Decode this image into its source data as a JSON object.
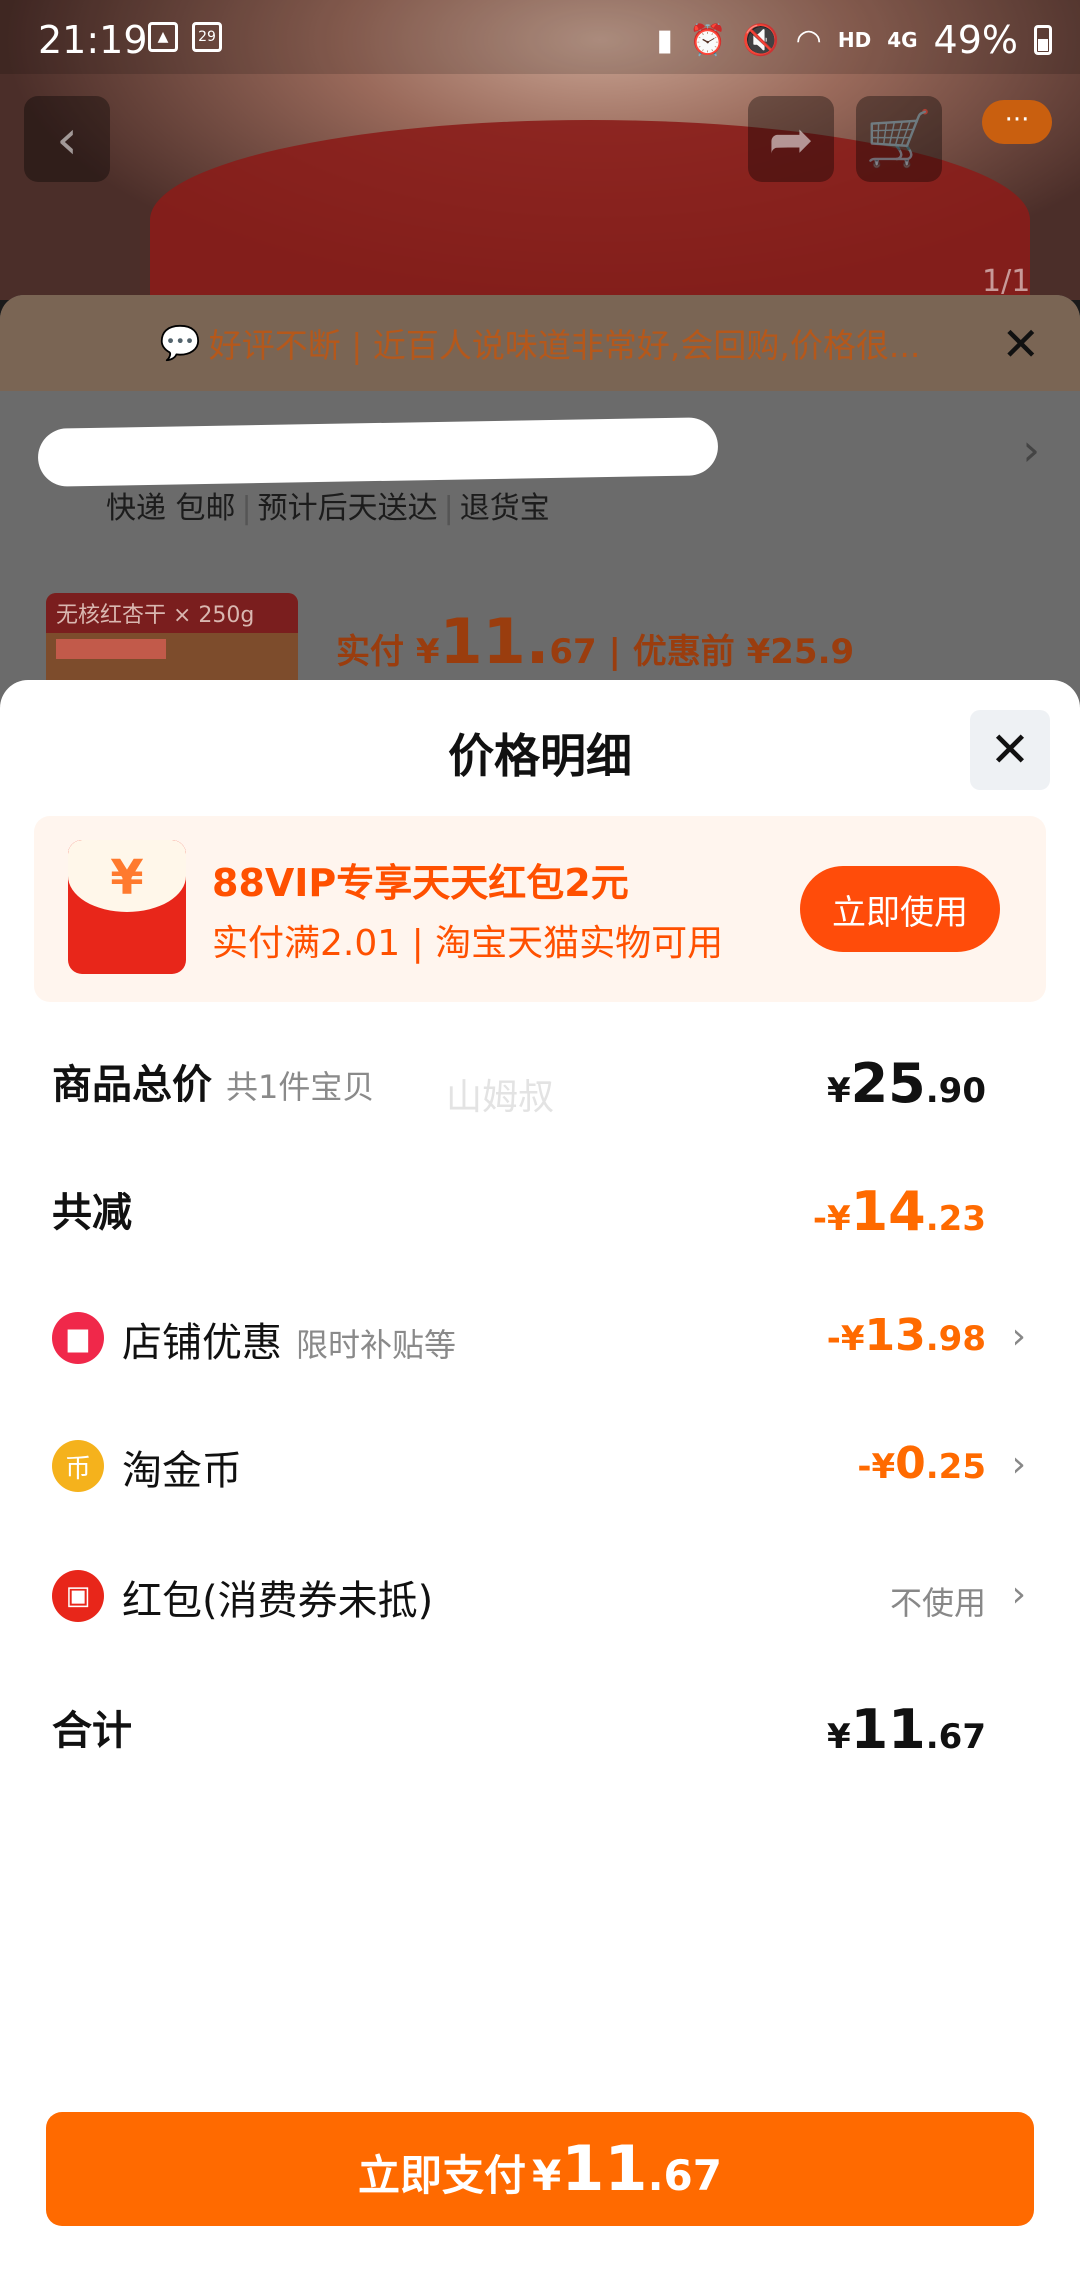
{
  "status_bar": {
    "time": "21:19",
    "calendar_day": "29",
    "network": "HD",
    "signal": "4G",
    "battery": "49%"
  },
  "background": {
    "page_count": "1/1",
    "review_text": "好评不断 | 近百人说味道非常好,会回购,价格很...",
    "shop_name": "",
    "shop_tags": [
      "快递 包邮",
      "预计后天送达",
      "退货宝"
    ],
    "product_thumb_text": "无核红杏干 × 250g",
    "paid_label": "实付",
    "paid_currency": "¥",
    "paid_int": "11.",
    "paid_dec": "67",
    "before_label": "| 优惠前 ¥25.9"
  },
  "sheet": {
    "title": "价格明细",
    "promo": {
      "icon": "yen-envelope-icon",
      "title": "88VIP专享天天红包2元",
      "subtitle": "实付满2.01 | 淘宝天猫实物可用",
      "button": "立即使用"
    },
    "watermark": "山姆叔",
    "rows": {
      "total_goods": {
        "label": "商品总价",
        "sub": "共1件宝贝",
        "currency": "¥",
        "int": "25",
        "dec": ".90"
      },
      "total_discount": {
        "label": "共减",
        "currency": "-¥",
        "int": "14",
        "dec": ".23"
      },
      "shop_discount": {
        "label": "店铺优惠",
        "sub": "限时补贴等",
        "currency": "-¥",
        "int": "13",
        "dec": ".98"
      },
      "taojinbi": {
        "label": "淘金币",
        "currency": "-¥",
        "int": "0",
        "dec": ".25",
        "coin_char": "币"
      },
      "red_packet": {
        "label": "红包(消费券未抵)",
        "value": "不使用"
      },
      "sum": {
        "label": "合计",
        "currency": "¥",
        "int": "11",
        "dec": ".67"
      }
    },
    "pay_button": {
      "label": "立即支付",
      "currency": "¥",
      "int": "11",
      "dec": ".67"
    }
  },
  "colors": {
    "accent_orange": "#ff6a00",
    "promo_red": "#ff4c0a",
    "promo_bg": "#fff5ee"
  }
}
